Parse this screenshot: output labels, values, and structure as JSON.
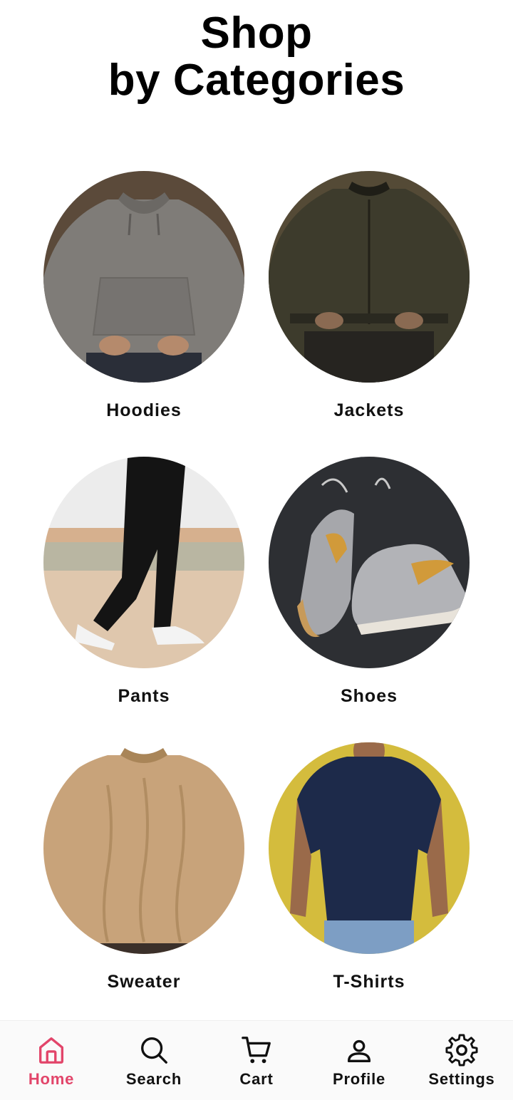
{
  "header": {
    "title_line1": "Shop",
    "title_line2": "by Categories"
  },
  "categories": [
    {
      "label": "Hoodies",
      "image": "gray-hoodie-photo"
    },
    {
      "label": "Jackets",
      "image": "olive-bomber-jacket-photo"
    },
    {
      "label": "Pants",
      "image": "black-pants-photo"
    },
    {
      "label": "Shoes",
      "image": "gray-sneakers-photo"
    },
    {
      "label": "Sweater",
      "image": "tan-cable-knit-sweater-photo"
    },
    {
      "label": "T-Shirts",
      "image": "navy-tshirt-photo"
    }
  ],
  "nav": {
    "active": "Home",
    "active_color": "#e2456a",
    "items": [
      {
        "label": "Home",
        "icon": "home-icon"
      },
      {
        "label": "Search",
        "icon": "search-icon"
      },
      {
        "label": "Cart",
        "icon": "cart-icon"
      },
      {
        "label": "Profile",
        "icon": "profile-icon"
      },
      {
        "label": "Settings",
        "icon": "settings-icon"
      }
    ]
  }
}
